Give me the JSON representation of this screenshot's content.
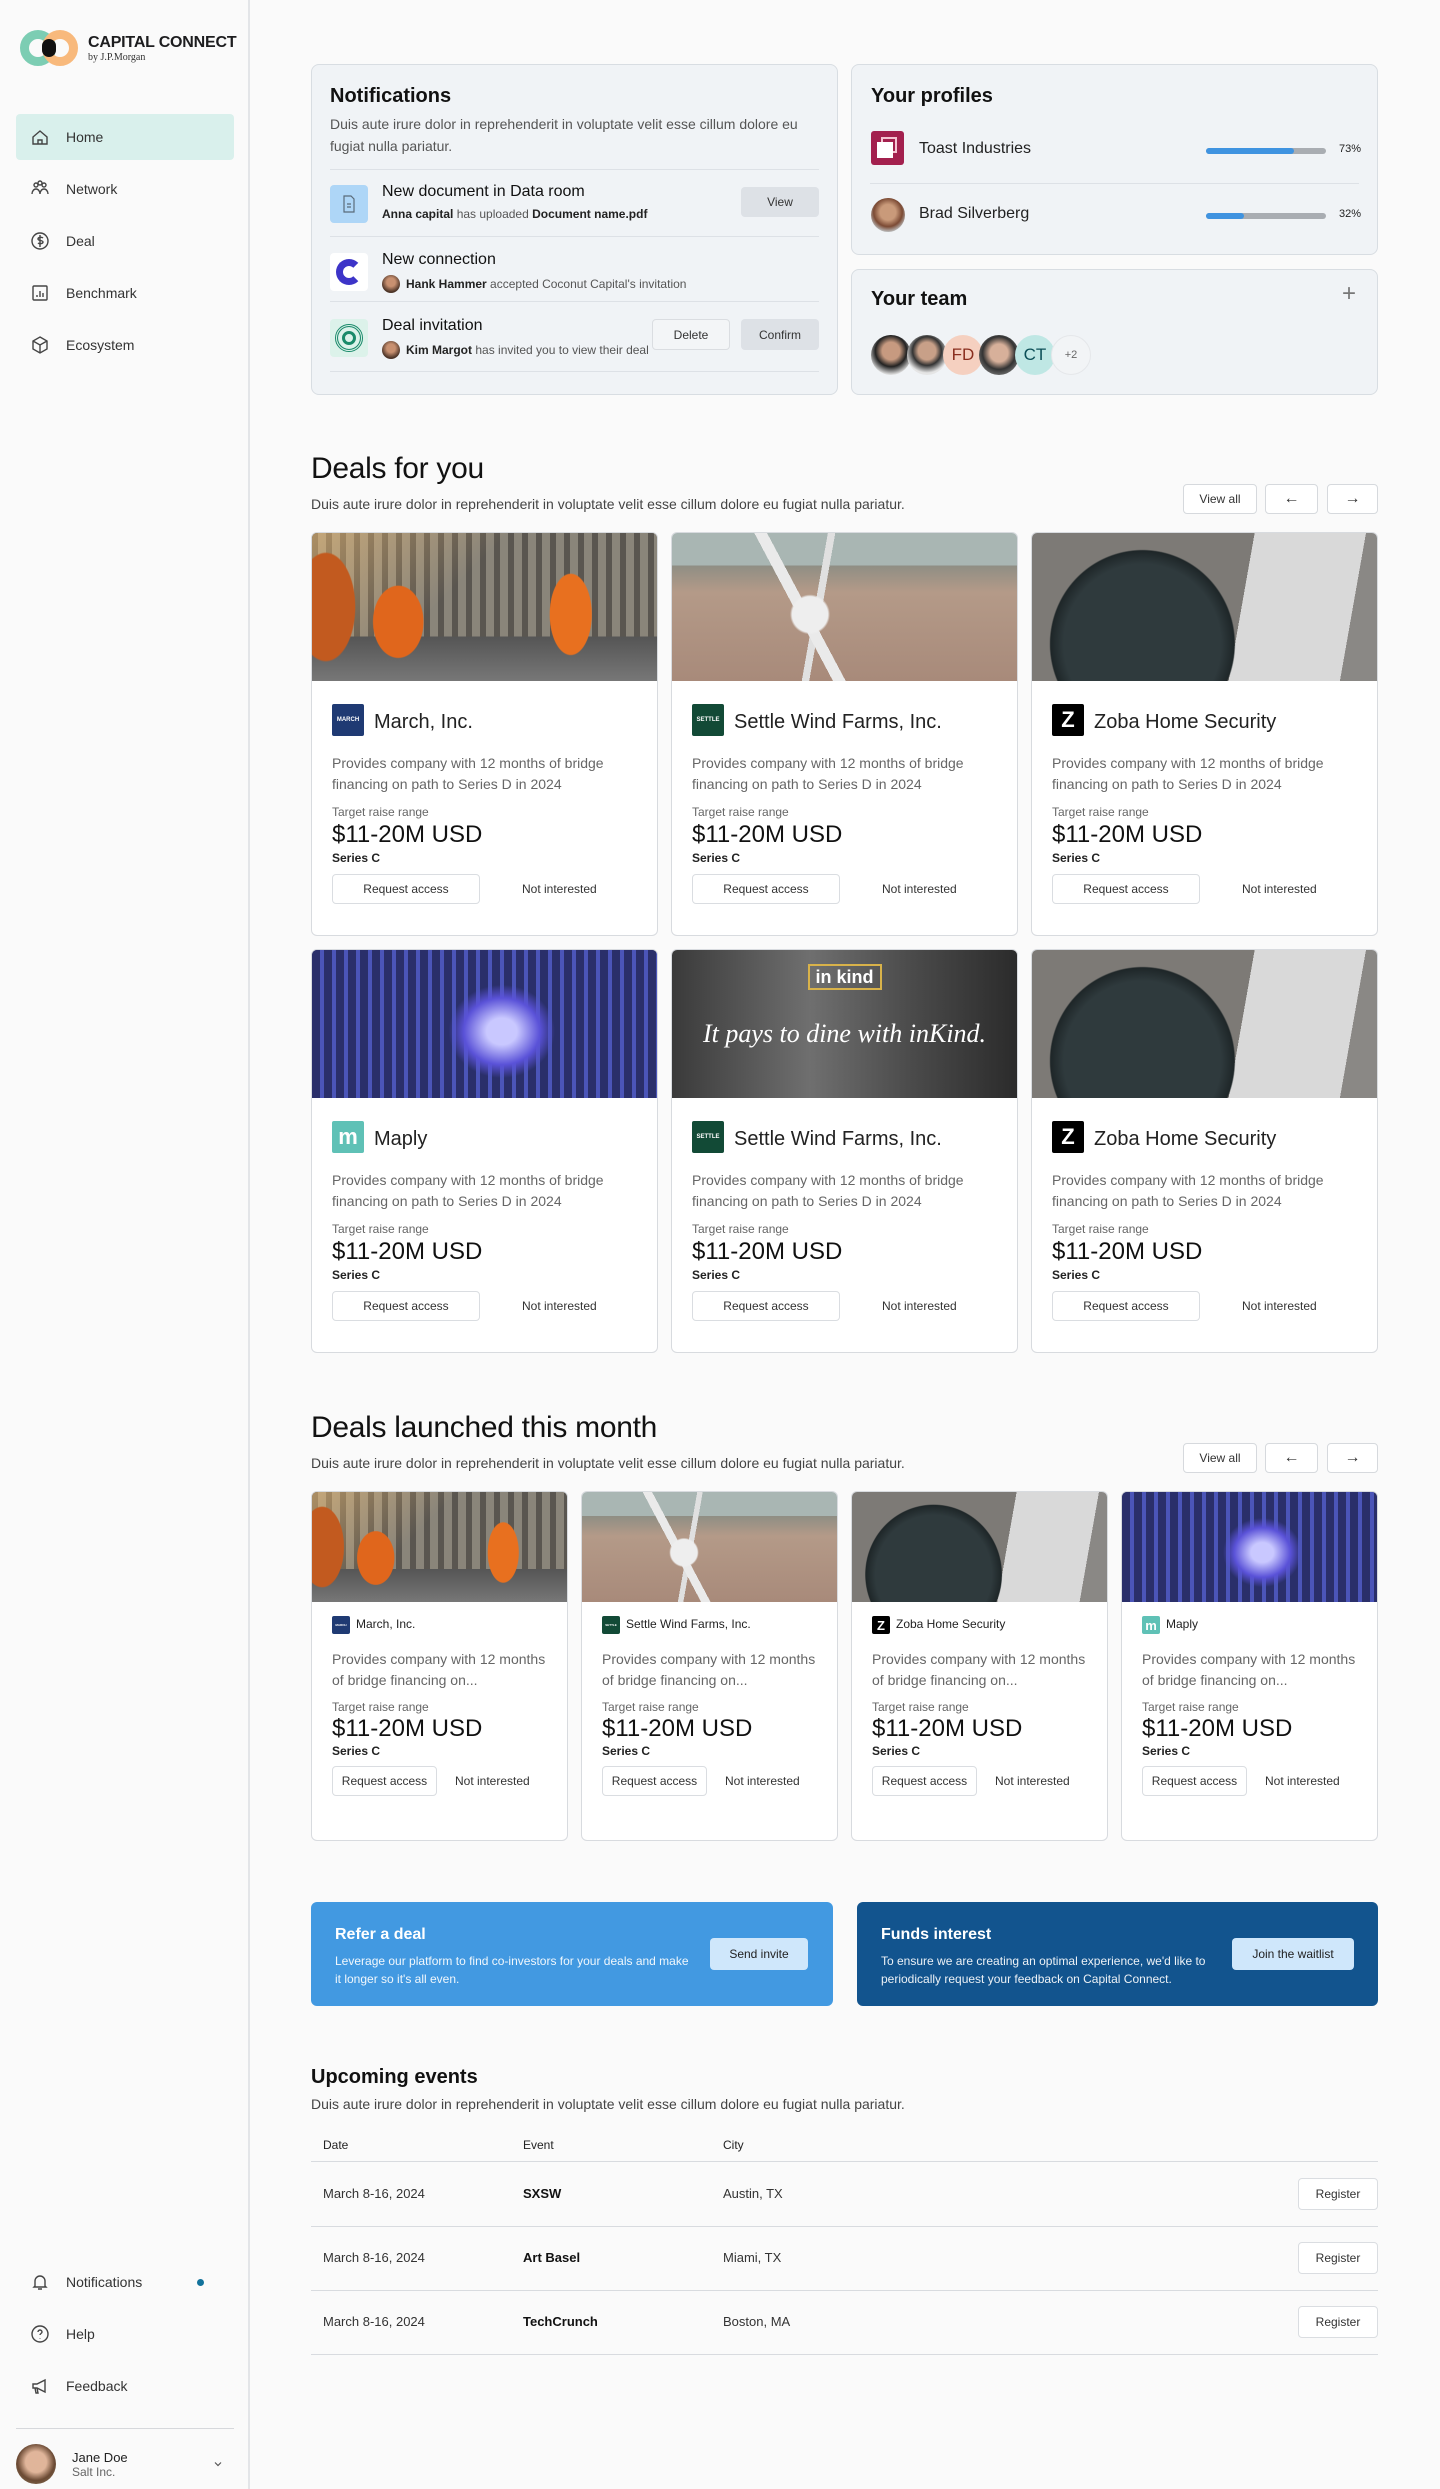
{
  "brand": {
    "name": "CAPITAL CONNECT",
    "byline": "by J.P.Morgan",
    "colors": {
      "green": "#7ccdb3",
      "orange": "#f8b97c",
      "active": "#d9f0ec",
      "accent": "#4299e1"
    }
  },
  "sidebar": {
    "items": [
      {
        "label": "Home",
        "icon": "home-icon",
        "active": true
      },
      {
        "label": "Network",
        "icon": "network-icon"
      },
      {
        "label": "Deal",
        "icon": "dollar-icon"
      },
      {
        "label": "Benchmark",
        "icon": "chart-icon"
      },
      {
        "label": "Ecosystem",
        "icon": "cube-icon"
      }
    ],
    "bottom": [
      {
        "label": "Notifications",
        "icon": "bell-icon",
        "dot": true
      },
      {
        "label": "Help",
        "icon": "help-icon"
      },
      {
        "label": "Feedback",
        "icon": "megaphone-icon"
      }
    ],
    "user": {
      "name": "Jane Doe",
      "company": "Salt Inc."
    }
  },
  "notifications": {
    "title": "Notifications",
    "description": "Duis aute irure dolor in reprehenderit in voluptate velit esse cillum dolore eu fugiat nulla pariatur.",
    "items": [
      {
        "title": "New document in Data room",
        "actor": "Anna capital",
        "text": "has uploaded",
        "object": "Document name.pdf",
        "actions": [
          "View"
        ]
      },
      {
        "title": "New connection",
        "actor": "Hank Hammer",
        "text": "accepted Coconut Capital's invitation",
        "object": "",
        "actions": []
      },
      {
        "title": "Deal invitation",
        "actor": "Kim Margot",
        "text": "has invited you to view their deal",
        "object": "",
        "actions": [
          "Delete",
          "Confirm"
        ]
      }
    ]
  },
  "profiles": {
    "title": "Your profiles",
    "items": [
      {
        "name": "Toast Industries",
        "progress": 73,
        "progress_label": "73%"
      },
      {
        "name": "Brad Silverberg",
        "progress": 32,
        "progress_label": "32%"
      }
    ]
  },
  "team": {
    "title": "Your team",
    "initials": [
      "FD",
      "CT"
    ],
    "more": "+2"
  },
  "deals_for_you": {
    "title": "Deals for you",
    "subtitle": "Duis aute irure dolor in reprehenderit in voluptate velit esse cillum dolore eu fugiat nulla pariatur.",
    "view_all": "View all",
    "prev": "←",
    "next": "→",
    "cards": [
      {
        "company": "March, Inc.",
        "logo": "MARCH",
        "logo_color": "#1f3a73",
        "image": "factory",
        "description": "Provides company with 12 months of bridge financing on path to Series D in 2024",
        "target_label": "Target raise range",
        "range": "$11-20M USD",
        "series": "Series C",
        "request": "Request access",
        "decline": "Not interested"
      },
      {
        "company": "Settle Wind Farms, Inc.",
        "logo": "SETTLE",
        "logo_color": "#124a36",
        "image": "wind",
        "description": "Provides company with 12 months of bridge financing on path to Series D in 2024",
        "target_label": "Target raise range",
        "range": "$11-20M USD",
        "series": "Series C",
        "request": "Request access",
        "decline": "Not interested"
      },
      {
        "company": "Zoba Home Security",
        "logo": "Z",
        "logo_color": "#000000",
        "image": "speaker",
        "description": "Provides company with 12 months of bridge financing on path to Series D in 2024",
        "target_label": "Target raise range",
        "range": "$11-20M USD",
        "series": "Series C",
        "request": "Request access",
        "decline": "Not interested"
      },
      {
        "company": "Maply",
        "logo": "m",
        "logo_color": "#5fc1b6",
        "image": "rocket",
        "description": "Provides company with 12 months of bridge financing on path to Series D in 2024",
        "target_label": "Target raise range",
        "range": "$11-20M USD",
        "series": "Series C",
        "request": "Request access",
        "decline": "Not interested"
      },
      {
        "company": "Settle Wind Farms, Inc.",
        "logo": "SETTLE",
        "logo_color": "#124a36",
        "image": "inkind",
        "ad_logo": "in kind",
        "ad_tagline": "It pays to dine with inKind.",
        "description": "Provides company with 12 months of bridge financing on path to Series D in 2024",
        "target_label": "Target raise range",
        "range": "$11-20M USD",
        "series": "Series C",
        "request": "Request access",
        "decline": "Not interested"
      },
      {
        "company": "Zoba Home Security",
        "logo": "Z",
        "logo_color": "#000000",
        "image": "speaker",
        "description": "Provides company with 12 months of bridge financing on path to Series D in 2024",
        "target_label": "Target raise range",
        "range": "$11-20M USD",
        "series": "Series C",
        "request": "Request access",
        "decline": "Not interested"
      }
    ]
  },
  "deals_launched": {
    "title": "Deals launched this month",
    "subtitle": "Duis aute irure dolor in reprehenderit in voluptate velit esse cillum dolore eu fugiat nulla pariatur.",
    "view_all": "View all",
    "prev": "←",
    "next": "→",
    "cards": [
      {
        "company": "March, Inc.",
        "logo": "MARCH",
        "logo_color": "#1f3a73",
        "image": "factory",
        "description": "Provides company with 12 months of bridge financing on...",
        "target_label": "Target raise range",
        "range": "$11-20M USD",
        "series": "Series C",
        "request": "Request access",
        "decline": "Not interested"
      },
      {
        "company": "Settle Wind Farms, Inc.",
        "logo": "SETTLE",
        "logo_color": "#124a36",
        "image": "wind",
        "description": "Provides company with 12 months of bridge financing on...",
        "target_label": "Target raise range",
        "range": "$11-20M USD",
        "series": "Series C",
        "request": "Request access",
        "decline": "Not interested"
      },
      {
        "company": "Zoba Home Security",
        "logo": "Z",
        "logo_color": "#000000",
        "image": "speaker",
        "description": "Provides company with 12 months of bridge financing on...",
        "target_label": "Target raise range",
        "range": "$11-20M USD",
        "series": "Series C",
        "request": "Request access",
        "decline": "Not interested"
      },
      {
        "company": "Maply",
        "logo": "m",
        "logo_color": "#5fc1b6",
        "image": "rocket",
        "description": "Provides company with 12 months of bridge financing on...",
        "target_label": "Target raise range",
        "range": "$11-20M USD",
        "series": "Series C",
        "request": "Request access",
        "decline": "Not interested"
      }
    ]
  },
  "banners": [
    {
      "title": "Refer a deal",
      "description": "Leverage our platform to find co-investors for your deals and make it longer so it's all even.",
      "button": "Send invite",
      "color": "#4299e1"
    },
    {
      "title": "Funds interest",
      "description": "To ensure we are creating an optimal experience, we'd like to periodically request your feedback on Capital Connect.",
      "button": "Join the waitlist",
      "color": "#12548e"
    }
  ],
  "events": {
    "title": "Upcoming events",
    "subtitle": "Duis aute irure dolor in reprehenderit in voluptate velit esse cillum dolore eu fugiat nulla pariatur.",
    "columns": [
      "Date",
      "Event",
      "City"
    ],
    "rows": [
      {
        "date": "March 8-16, 2024",
        "event": "SXSW",
        "city": "Austin, TX",
        "action": "Register"
      },
      {
        "date": "March 8-16, 2024",
        "event": "Art Basel",
        "city": "Miami, TX",
        "action": "Register"
      },
      {
        "date": "March 8-16, 2024",
        "event": "TechCrunch",
        "city": "Boston, MA",
        "action": "Register"
      }
    ]
  }
}
